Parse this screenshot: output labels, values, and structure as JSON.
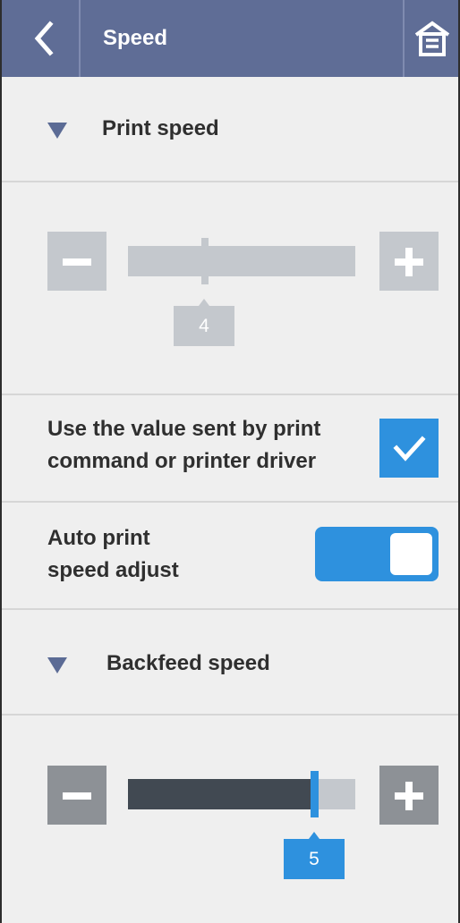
{
  "header": {
    "title": "Speed"
  },
  "print_speed": {
    "label": "Print speed",
    "value": "4",
    "min": 1,
    "max": 10,
    "enabled": false
  },
  "use_driver_value": {
    "label_line1": "Use the value sent by print",
    "label_line2": "command or printer driver",
    "checked": true
  },
  "auto_adjust": {
    "label_line1": "Auto print",
    "label_line2": "speed adjust",
    "on": true
  },
  "backfeed_speed": {
    "label": "Backfeed speed",
    "value": "5",
    "min": 1,
    "max": 5,
    "enabled": true
  },
  "colors": {
    "header_bg": "#5f6d96",
    "accent": "#2e91de",
    "disabled": "#c4c8cd",
    "track_fill": "#414952",
    "button_active": "#8d9196"
  },
  "icons": {
    "back": "chevron-left-icon",
    "home": "home-icon",
    "expand": "triangle-down-icon",
    "check": "check-icon",
    "minus": "minus-icon",
    "plus": "plus-icon"
  }
}
